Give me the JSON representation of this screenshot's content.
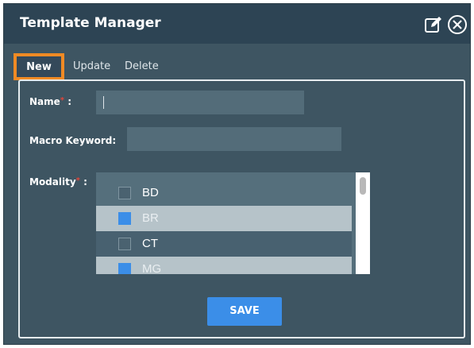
{
  "window": {
    "title": "Template Manager"
  },
  "titlebar_icons": [
    "edit-icon",
    "close-icon"
  ],
  "tabs": [
    {
      "label": "New",
      "active": true
    },
    {
      "label": "Update",
      "active": false
    },
    {
      "label": "Delete",
      "active": false
    }
  ],
  "form": {
    "name_label": "Name",
    "name_required": "*",
    "name_colon": ":",
    "name_value": "",
    "macro_label": "Macro Keyword:",
    "macro_value": "",
    "modality_label": "Modality",
    "modality_required": "*",
    "modality_colon": ":",
    "modality_options": [
      {
        "label": "BD",
        "checked": false
      },
      {
        "label": "BR",
        "checked": true
      },
      {
        "label": "CT",
        "checked": false
      },
      {
        "label": "MG",
        "checked": true
      }
    ]
  },
  "save_label": "SAVE",
  "colors": {
    "accent": "#3b8ee8",
    "highlight": "#f08a24",
    "titlebar": "#2d4454",
    "panel": "#3e5562"
  }
}
